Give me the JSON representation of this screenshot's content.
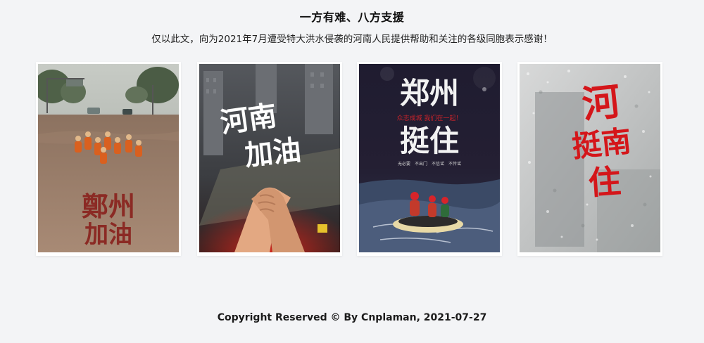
{
  "header": {
    "title": "一方有难、八方支援",
    "subtitle": "仅以此文，向为2021年7月遭受特大洪水侵袭的河南人民提供帮助和关注的各级同胞表示感谢！"
  },
  "posters": [
    {
      "name": "zhengzhou-jiayou-poster",
      "line1": "鄭州",
      "line2": "加油",
      "colors": {
        "sky": "#b9bdb7",
        "water": "#8a6a55",
        "text": "#8b2a24"
      }
    },
    {
      "name": "henan-jiayou-poster",
      "line1": "河南",
      "line2": "加油",
      "colors": {
        "sky": "#4a4d52",
        "text": "#ffffff",
        "glow": "#c2221b"
      }
    },
    {
      "name": "zhengzhou-tingzhu-poster",
      "line1": "郑州",
      "line2": "挺住",
      "tagline": "众志成城 我们在一起！",
      "slogan": "无必要　不出门　不信谣　不传谣",
      "colors": {
        "bg": "#1c1a2e",
        "text": "#f2f2f2",
        "accent": "#c8232b"
      }
    },
    {
      "name": "henan-tingzhu-poster",
      "line1": "河",
      "line2": "挺南",
      "line3": "住",
      "colors": {
        "bg": "#bfc1c1",
        "text": "#d4161a"
      }
    }
  ],
  "footer": {
    "copyright": "Copyright Reserved © By Cnplaman, 2021-07-27"
  }
}
